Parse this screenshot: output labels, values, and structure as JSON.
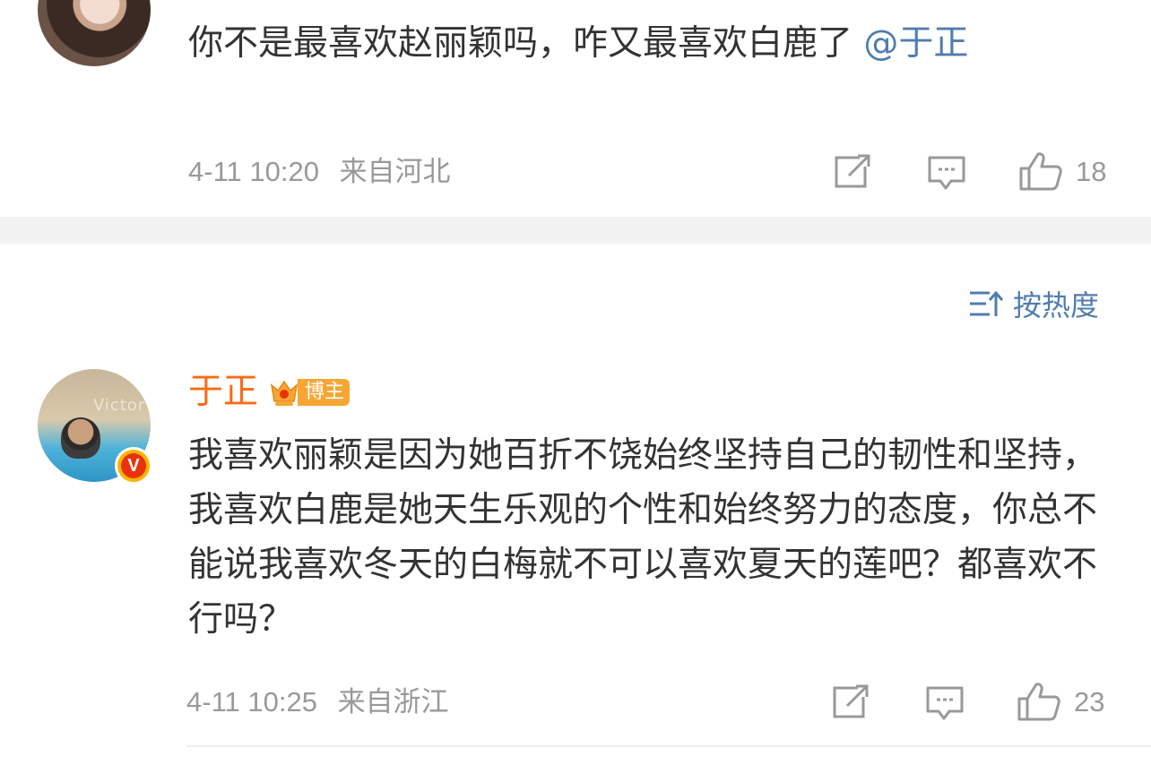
{
  "comment1": {
    "avatar": "user-avatar-photo",
    "text": "你不是最喜欢赵丽颖吗，咋又最喜欢白鹿了",
    "mention": "@于正",
    "time": "4-11 10:20",
    "source": "来自河北",
    "like_count": "18"
  },
  "sort": {
    "label": "按热度",
    "icon": "sort-icon"
  },
  "comment2": {
    "avatar": "author-avatar-photo",
    "avatar_watermark": "Victor",
    "verified_badge": "V",
    "author_name": "于正",
    "badge_label": "博主",
    "text": "我喜欢丽颖是因为她百折不饶始终坚持自己的韧性和坚持，我喜欢白鹿是她天生乐观的个性和始终努力的态度，你总不能说我喜欢冬天的白梅就不可以喜欢夏天的莲吧？都喜欢不行吗？",
    "time": "4-11 10:25",
    "source": "来自浙江",
    "like_count": "23"
  },
  "icons": {
    "repost": "repost-icon",
    "comment": "comment-icon",
    "like": "thumbs-up-icon"
  },
  "colors": {
    "text": "#333333",
    "meta": "#999999",
    "link": "#507daf",
    "author": "#f86c15",
    "badge": "#f7a534",
    "verified": "#e8320b",
    "divider": "#f2f2f2"
  }
}
